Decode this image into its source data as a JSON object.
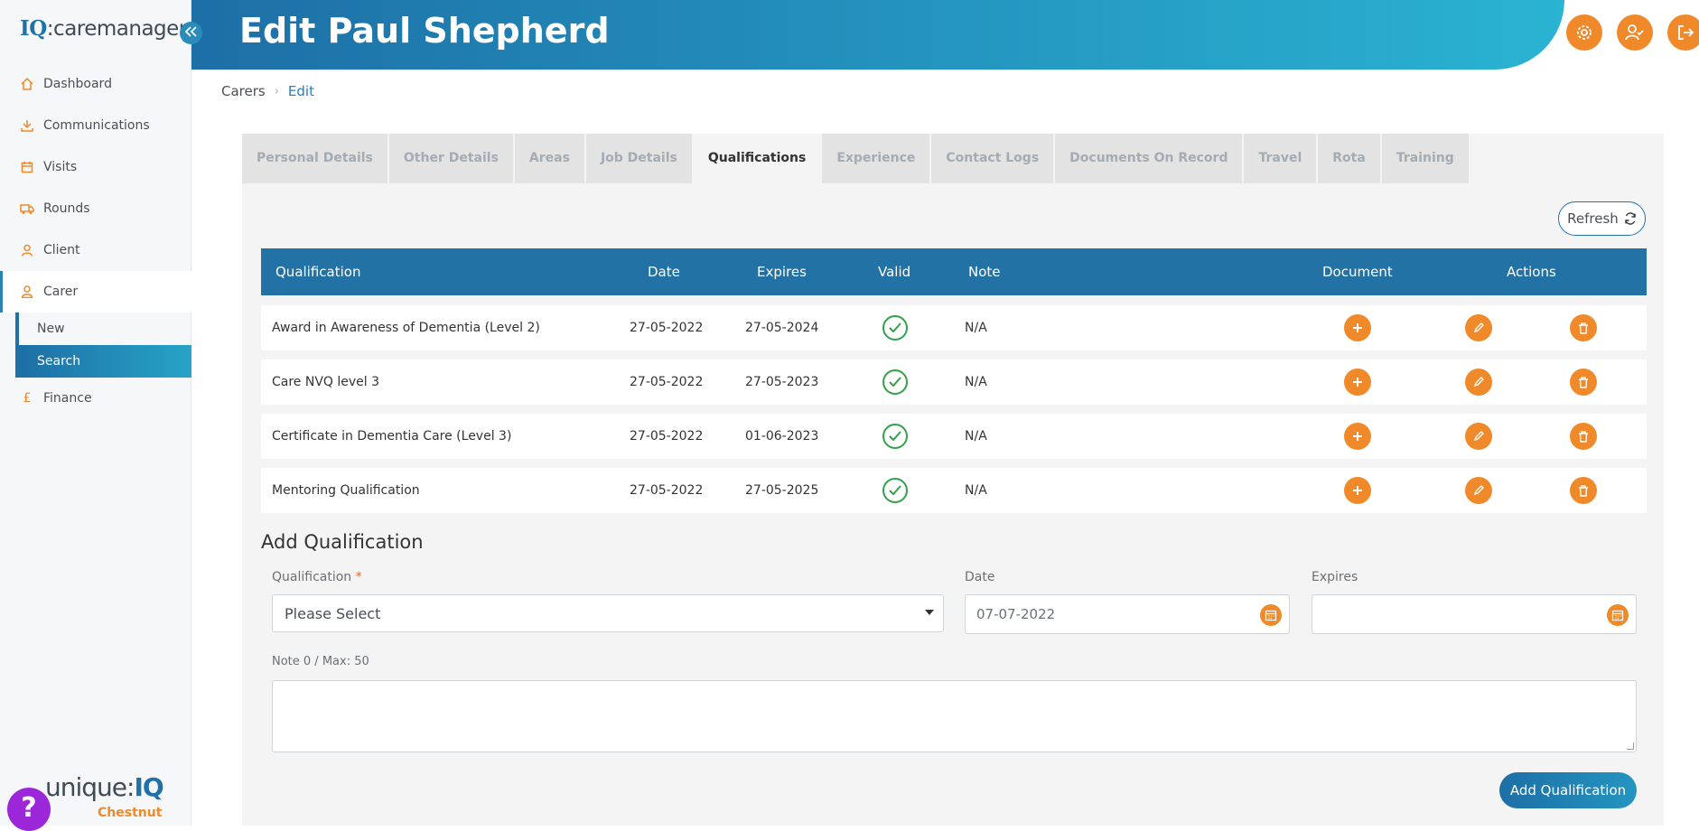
{
  "brand": {
    "logo_prefix": "IQ",
    "logo_suffix": ":caremanager",
    "bottom_prefix": "unique:",
    "bottom_iq": "IQ",
    "bottom_sub": "Chestnut",
    "help_label": "?"
  },
  "sidebar": {
    "items": [
      {
        "label": "Dashboard",
        "icon": "home-icon"
      },
      {
        "label": "Communications",
        "icon": "download-icon"
      },
      {
        "label": "Visits",
        "icon": "calendar-icon"
      },
      {
        "label": "Rounds",
        "icon": "truck-icon"
      },
      {
        "label": "Client",
        "icon": "user-icon"
      },
      {
        "label": "Carer",
        "icon": "carer-icon"
      }
    ],
    "sub_items": [
      {
        "label": "New"
      },
      {
        "label": "Search"
      }
    ],
    "finance": {
      "label": "Finance",
      "icon": "pound-icon",
      "symbol": "£"
    }
  },
  "header": {
    "title": "Edit Paul Shepherd"
  },
  "breadcrumb": {
    "parent": "Carers",
    "current": "Edit"
  },
  "tabs": [
    "Personal Details",
    "Other Details",
    "Areas",
    "Job Details",
    "Qualifications",
    "Experience",
    "Contact Logs",
    "Documents On Record",
    "Travel",
    "Rota",
    "Training"
  ],
  "active_tab": "Qualifications",
  "refresh_label": "Refresh",
  "table": {
    "headers": {
      "qualification": "Qualification",
      "date": "Date",
      "expires": "Expires",
      "valid": "Valid",
      "note": "Note",
      "document": "Document",
      "actions": "Actions"
    },
    "rows": [
      {
        "qualification": "Award in Awareness of Dementia (Level 2)",
        "date": "27-05-2022",
        "expires": "27-05-2024",
        "valid": true,
        "note": "N/A"
      },
      {
        "qualification": "Care NVQ level 3",
        "date": "27-05-2022",
        "expires": "27-05-2023",
        "valid": true,
        "note": "N/A"
      },
      {
        "qualification": "Certificate in Dementia Care (Level 3)",
        "date": "27-05-2022",
        "expires": "01-06-2023",
        "valid": true,
        "note": "N/A"
      },
      {
        "qualification": "Mentoring Qualification",
        "date": "27-05-2022",
        "expires": "27-05-2025",
        "valid": true,
        "note": "N/A"
      }
    ]
  },
  "form": {
    "title": "Add Qualification",
    "qualification_label": "Qualification",
    "required_mark": "*",
    "qualification_value": "Please Select",
    "date_label": "Date",
    "date_value": "07-07-2022",
    "expires_label": "Expires",
    "expires_value": "",
    "note_label": "Note 0 / Max: 50",
    "submit_label": "Add Qualification"
  },
  "colors": {
    "primary": "#2272a5",
    "accent": "#f0892a",
    "valid": "#35a04a"
  }
}
